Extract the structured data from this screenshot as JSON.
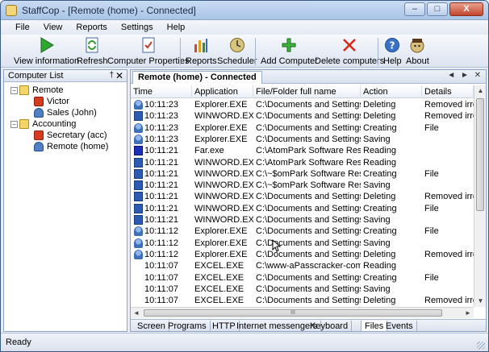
{
  "window": {
    "title": "StaffCop - [Remote (home) - Connected]",
    "minimize": "–",
    "maximize": "□",
    "close": "X"
  },
  "menu": [
    "File",
    "View",
    "Reports",
    "Settings",
    "Help"
  ],
  "toolbar": {
    "view_information": "View information",
    "refresh": "Refresh",
    "computer_properties": "Computer Properties",
    "reports": "Reports",
    "scheduler": "Scheduler",
    "add_computer": "Add Computer",
    "delete_computers": "Delete computers",
    "help": "Help",
    "about": "About"
  },
  "computer_list": {
    "title": "Computer List",
    "pin": "†",
    "close": "✕",
    "tree": [
      {
        "label": "Remote",
        "type": "folder",
        "toggle": "−"
      },
      {
        "label": "Victor",
        "type": "stop"
      },
      {
        "label": "Sales (John)",
        "type": "pc"
      },
      {
        "label": "Accounting",
        "type": "folder",
        "toggle": "−"
      },
      {
        "label": "Secretary (acc)",
        "type": "stop"
      },
      {
        "label": "Remote (home)",
        "type": "pc"
      }
    ]
  },
  "main": {
    "tab_title": "Remote (home) - Connected",
    "nav": "◄ ► ✕",
    "columns": [
      "Time",
      "Application",
      "File/Folder full name",
      "Action",
      "Details"
    ],
    "rows": [
      {
        "icon": "explorer",
        "time": "10:11:23",
        "app": "Explorer.EXE",
        "path": "C:\\Documents and Settings\\...",
        "action": "Deleting",
        "details": "Removed irret"
      },
      {
        "icon": "winword",
        "time": "10:11:23",
        "app": "WINWORD.EXE",
        "path": "C:\\Documents and Settings\\...",
        "action": "Deleting",
        "details": "Removed irret"
      },
      {
        "icon": "explorer",
        "time": "10:11:23",
        "app": "Explorer.EXE",
        "path": "C:\\Documents and Settings\\...",
        "action": "Creating",
        "details": "File"
      },
      {
        "icon": "explorer",
        "time": "10:11:23",
        "app": "Explorer.EXE",
        "path": "C:\\Documents and Settings\\...",
        "action": "Saving",
        "details": ""
      },
      {
        "icon": "far",
        "time": "10:11:21",
        "app": "Far.exe",
        "path": "C:\\AtomPark Software Resell...",
        "action": "Reading",
        "details": ""
      },
      {
        "icon": "winword",
        "time": "10:11:21",
        "app": "WINWORD.EXE",
        "path": "C:\\AtomPark Software Resell...",
        "action": "Reading",
        "details": ""
      },
      {
        "icon": "winword",
        "time": "10:11:21",
        "app": "WINWORD.EXE",
        "path": "C:\\~$omPark Software Resel...",
        "action": "Creating",
        "details": "File"
      },
      {
        "icon": "winword",
        "time": "10:11:21",
        "app": "WINWORD.EXE",
        "path": "C:\\~$omPark Software Resel...",
        "action": "Saving",
        "details": ""
      },
      {
        "icon": "winword",
        "time": "10:11:21",
        "app": "WINWORD.EXE",
        "path": "C:\\Documents and Settings\\...",
        "action": "Deleting",
        "details": "Removed irret"
      },
      {
        "icon": "winword",
        "time": "10:11:21",
        "app": "WINWORD.EXE",
        "path": "C:\\Documents and Settings\\...",
        "action": "Creating",
        "details": "File"
      },
      {
        "icon": "winword",
        "time": "10:11:21",
        "app": "WINWORD.EXE",
        "path": "C:\\Documents and Settings\\...",
        "action": "Saving",
        "details": ""
      },
      {
        "icon": "explorer",
        "time": "10:11:12",
        "app": "Explorer.EXE",
        "path": "C:\\Documents and Settings\\...",
        "action": "Creating",
        "details": "File"
      },
      {
        "icon": "explorer",
        "time": "10:11:12",
        "app": "Explorer.EXE",
        "path": "C:\\Documents and Settings\\...",
        "action": "Saving",
        "details": ""
      },
      {
        "icon": "explorer",
        "time": "10:11:12",
        "app": "Explorer.EXE",
        "path": "C:\\Documents and Settings\\...",
        "action": "Deleting",
        "details": "Removed irret"
      },
      {
        "icon": "",
        "time": "10:11:07",
        "app": "EXCEL.EXE",
        "path": "C:\\www-aPasscracker-com....",
        "action": "Reading",
        "details": ""
      },
      {
        "icon": "",
        "time": "10:11:07",
        "app": "EXCEL.EXE",
        "path": "C:\\Documents and Settings\\...",
        "action": "Creating",
        "details": "File"
      },
      {
        "icon": "",
        "time": "10:11:07",
        "app": "EXCEL.EXE",
        "path": "C:\\Documents and Settings\\...",
        "action": "Saving",
        "details": ""
      },
      {
        "icon": "",
        "time": "10:11:07",
        "app": "EXCEL.EXE",
        "path": "C:\\Documents and Settings\\...",
        "action": "Deleting",
        "details": "Removed irret"
      }
    ],
    "scroll_up": "▲",
    "scroll_down": "▼",
    "scroll_left": "◄",
    "scroll_right": "►",
    "hscroll_grip": "III"
  },
  "bottom_tabs": [
    "Screen",
    "Programs",
    "HTTP",
    "Internet messengers",
    "Keyboard",
    "Files",
    "Events"
  ],
  "active_bottom_tab": "Files",
  "status": "Ready",
  "colors": {
    "accent": "#3c5a86",
    "toolbar_bg": "#dce4f0",
    "close_red": "#c2452c"
  }
}
